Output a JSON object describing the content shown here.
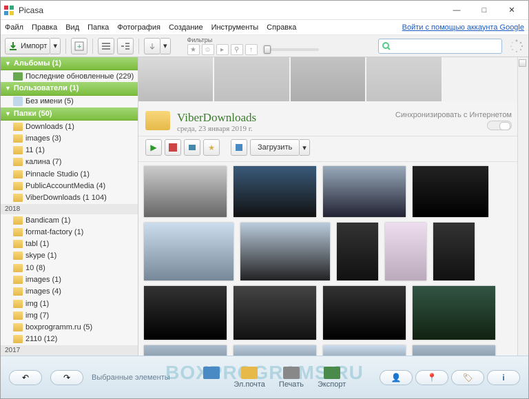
{
  "app": {
    "title": "Picasa",
    "login_link": "Войти с помощью аккаунта Google"
  },
  "menu": [
    "Файл",
    "Правка",
    "Вид",
    "Папка",
    "Фотография",
    "Создание",
    "Инструменты",
    "Справка"
  ],
  "toolbar": {
    "import": "Импорт",
    "filters_label": "Фильтры",
    "search_placeholder": ""
  },
  "sidebar": {
    "albums": {
      "title": "Альбомы (1)",
      "items": [
        {
          "label": "Последние обновленные (229)"
        }
      ]
    },
    "users": {
      "title": "Пользователи (1)",
      "items": [
        {
          "label": "Без имени (5)"
        }
      ]
    },
    "folders": {
      "title": "Папки (50)",
      "items": [
        {
          "label": "Downloads (1)"
        },
        {
          "label": "images (3)"
        },
        {
          "label": "11 (1)"
        },
        {
          "label": "калина (7)"
        },
        {
          "label": "Pinnacle Studio (1)"
        },
        {
          "label": "PublicAccountMedia (4)"
        },
        {
          "label": "ViberDownloads (1 104)"
        }
      ],
      "year1": "2018",
      "items2": [
        {
          "label": "Bandicam (1)"
        },
        {
          "label": "format-factory (1)"
        },
        {
          "label": "tabl (1)"
        },
        {
          "label": "skype (1)"
        },
        {
          "label": "10 (8)"
        },
        {
          "label": "images (1)"
        },
        {
          "label": "images (4)"
        },
        {
          "label": "img (1)"
        },
        {
          "label": "img (7)"
        },
        {
          "label": "boxprogramm.ru (5)"
        },
        {
          "label": "2110 (12)"
        }
      ],
      "year2": "2017"
    }
  },
  "folder_header": {
    "name": "ViberDownloads",
    "date": "среда, 23 января 2019 г.",
    "sync_label": "Синхронизировать с Интернетом",
    "upload": "Загрузить"
  },
  "bottom": {
    "selected": "Выбранные элементы",
    "actions": [
      "",
      "Эл.почта",
      "Печать",
      "Экспорт"
    ]
  },
  "watermark": "BOXPROGRAMS.RU"
}
